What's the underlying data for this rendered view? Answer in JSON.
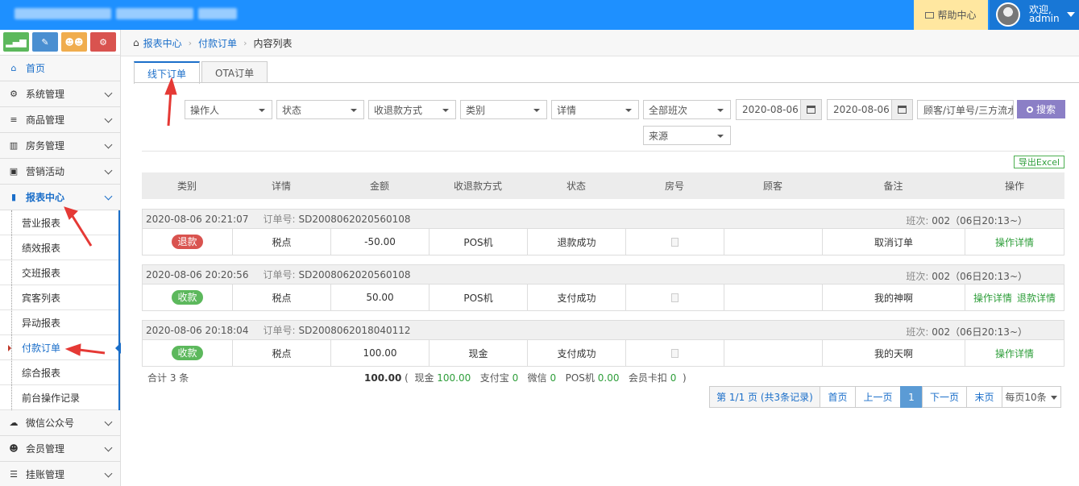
{
  "topbar": {
    "help_label": "帮助中心",
    "welcome": "欢迎,",
    "username": "admin"
  },
  "sidebar": {
    "shortcuts": [
      {
        "icon": "signal-icon",
        "color": "#5cb85c"
      },
      {
        "icon": "pencil-icon",
        "color": "#4a8fd1"
      },
      {
        "icon": "users-icon",
        "color": "#f0ad4e"
      },
      {
        "icon": "cogs-icon",
        "color": "#d9534f"
      }
    ],
    "items": [
      {
        "label": "首页",
        "icon": "home-icon",
        "glyph": "⌂"
      },
      {
        "label": "系统管理",
        "icon": "gear-icon",
        "glyph": "⚙"
      },
      {
        "label": "商品管理",
        "icon": "database-icon",
        "glyph": "≡"
      },
      {
        "label": "房务管理",
        "icon": "bank-icon",
        "glyph": "▥"
      },
      {
        "label": "营销活动",
        "icon": "gift-icon",
        "glyph": "▣"
      },
      {
        "label": "报表中心",
        "icon": "bar-chart-icon",
        "glyph": "▮"
      },
      {
        "label": "微信公众号",
        "icon": "cloud-icon",
        "glyph": "☁"
      },
      {
        "label": "会员管理",
        "icon": "users-icon",
        "glyph": "☻"
      },
      {
        "label": "挂账管理",
        "icon": "list-icon",
        "glyph": "☰"
      }
    ],
    "report_sub": [
      "营业报表",
      "绩效报表",
      "交班报表",
      "宾客列表",
      "异动报表",
      "付款订单",
      "综合报表",
      "前台操作记录"
    ]
  },
  "breadcrumb": [
    "报表中心",
    "付款订单",
    "内容列表"
  ],
  "tabs": [
    "线下订单",
    "OTA订单"
  ],
  "filters": {
    "operator": "操作人",
    "status": "状态",
    "method": "收退款方式",
    "category": "类别",
    "detail": "详情",
    "shift": "全部班次",
    "date_from": "2020-08-06",
    "date_to": "2020-08-06",
    "search_placeholder": "顾客/订单号/三方流水号",
    "search_label": "搜索",
    "source": "来源"
  },
  "export_label": "导出Excel",
  "table": {
    "headers": [
      "类别",
      "详情",
      "金额",
      "收退款方式",
      "状态",
      "房号",
      "顾客",
      "备注",
      "操作"
    ],
    "order_no_label": "订单号:",
    "shift_label": "班次:",
    "groups": [
      {
        "time": "2020-08-06 20:21:07",
        "order_no": "SD2008062020560108",
        "shift": "002（06日20:13~）",
        "type": "退款",
        "type_color": "#d9534f",
        "detail": "税点",
        "amount": "-50.00",
        "method": "POS机",
        "status": "退款成功",
        "room": "",
        "customer": "",
        "remark": "取消订单",
        "ops": [
          "操作详情"
        ]
      },
      {
        "time": "2020-08-06 20:20:56",
        "order_no": "SD2008062020560108",
        "shift": "002（06日20:13~）",
        "type": "收款",
        "type_color": "#5cb85c",
        "detail": "税点",
        "amount": "50.00",
        "method": "POS机",
        "status": "支付成功",
        "room": "",
        "customer": "",
        "remark": "我的神啊",
        "ops": [
          "操作详情",
          "退款详情"
        ]
      },
      {
        "time": "2020-08-06 20:18:04",
        "order_no": "SD2008062018040112",
        "shift": "002（06日20:13~）",
        "type": "收款",
        "type_color": "#5cb85c",
        "detail": "税点",
        "amount": "100.00",
        "method": "现金",
        "status": "支付成功",
        "room": "",
        "customer": "",
        "remark": "我的天啊",
        "ops": [
          "操作详情"
        ]
      }
    ]
  },
  "summary": {
    "count": "合计 3 条",
    "total": "100.00",
    "cash_label": "现金",
    "cash": "100.00",
    "alipay_label": "支付宝",
    "alipay": "0",
    "wechat_label": "微信",
    "wechat": "0",
    "pos_label": "POS机",
    "pos": "0.00",
    "card_label": "会员卡扣",
    "card": "0"
  },
  "pager": {
    "info": "第 1/1 页 (共3条记录)",
    "first": "首页",
    "prev": "上一页",
    "current": "1",
    "next": "下一页",
    "last": "末页",
    "page_size": "每页10条"
  }
}
